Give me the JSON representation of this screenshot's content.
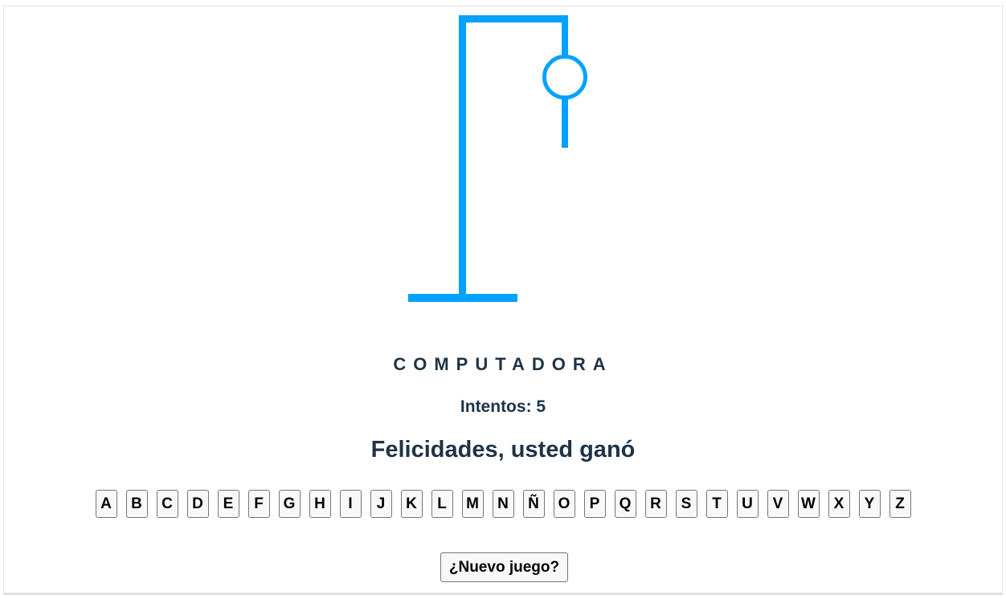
{
  "game": {
    "word_display": "COMPUTADORA",
    "attempts_label": "Intentos:",
    "attempts_value": "5",
    "status_message": "Felicidades, usted ganó",
    "accent_color": "#00a2ff",
    "text_color": "#1e3347"
  },
  "hangman": {
    "parts_shown": [
      "base",
      "pole",
      "beam",
      "rope",
      "head",
      "body"
    ]
  },
  "alphabet": [
    "A",
    "B",
    "C",
    "D",
    "E",
    "F",
    "G",
    "H",
    "I",
    "J",
    "K",
    "L",
    "M",
    "N",
    "Ñ",
    "O",
    "P",
    "Q",
    "R",
    "S",
    "T",
    "U",
    "V",
    "W",
    "X",
    "Y",
    "Z"
  ],
  "buttons": {
    "new_game_label": "¿Nuevo juego?"
  }
}
